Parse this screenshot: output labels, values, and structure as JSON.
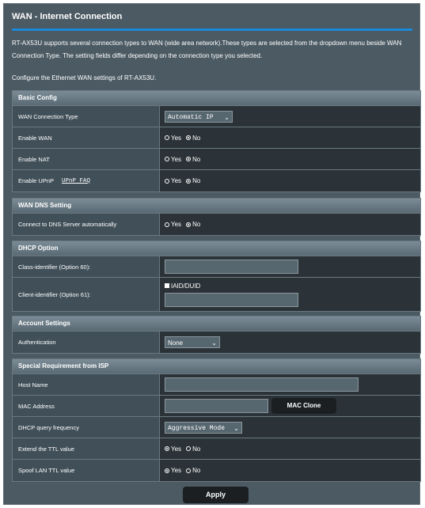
{
  "page": {
    "title": "WAN - Internet Connection",
    "intro": "RT-AX53U supports several connection types to WAN (wide area network).These types are selected from the dropdown menu beside WAN Connection Type. The setting fields differ depending on the connection type you selected.",
    "intro2": "Configure the Ethernet WAN settings of RT-AX53U."
  },
  "colors": {
    "accent": "#1c88d8",
    "panel": "#4b5a63",
    "value_bg": "#2b3338"
  },
  "radio": {
    "yes": "Yes",
    "no": "No"
  },
  "basic": {
    "heading": "Basic Config",
    "wan_type_label": "WAN Connection Type",
    "wan_type_value": "Automatic IP",
    "enable_wan_label": "Enable WAN",
    "enable_wan": "Yes",
    "enable_nat_label": "Enable NAT",
    "enable_nat": "Yes",
    "enable_upnp_label": "Enable UPnP",
    "upnp_faq": "UPnP FAQ",
    "enable_upnp": "Yes"
  },
  "dns": {
    "heading": "WAN DNS Setting",
    "auto_label": "Connect to DNS Server automatically",
    "auto": "Yes"
  },
  "dhcp": {
    "heading": "DHCP Option",
    "class_label": "Class-identifier (Option 60):",
    "class_value": "",
    "client_label": "Client-identifier (Option 61):",
    "iaid_label": "IAID/DUID",
    "iaid_checked": false,
    "client_value": ""
  },
  "account": {
    "heading": "Account Settings",
    "auth_label": "Authentication",
    "auth_value": "None"
  },
  "isp": {
    "heading": "Special Requirement from ISP",
    "host_label": "Host Name",
    "host_value": "",
    "mac_label": "MAC Address",
    "mac_value": "",
    "mac_clone": "MAC Clone",
    "dhcp_freq_label": "DHCP query frequency",
    "dhcp_freq_value": "Aggressive Mode",
    "ttl_label": "Extend the TTL value",
    "ttl": "No",
    "spoof_label": "Spoof LAN TTL value",
    "spoof": "No"
  },
  "apply": "Apply"
}
